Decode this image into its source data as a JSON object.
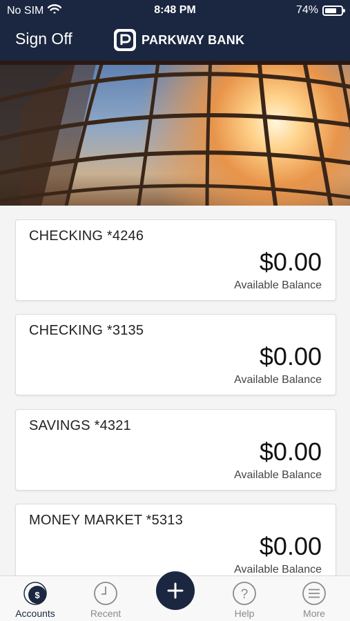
{
  "status_bar": {
    "carrier": "No SIM",
    "time": "8:48 PM",
    "battery": "74%",
    "battery_level": 0.74
  },
  "header": {
    "sign_off_label": "Sign Off",
    "brand_name": "PARKWAY BANK"
  },
  "accounts": [
    {
      "name": "CHECKING *4246",
      "balance": "$0.00",
      "caption": "Available Balance"
    },
    {
      "name": "CHECKING *3135",
      "balance": "$0.00",
      "caption": "Available Balance"
    },
    {
      "name": "SAVINGS *4321",
      "balance": "$0.00",
      "caption": "Available Balance"
    },
    {
      "name": "MONEY MARKET *5313",
      "balance": "$0.00",
      "caption": "Available Balance"
    }
  ],
  "tabbar": {
    "items": [
      {
        "label": "Accounts",
        "icon": "accounts-dollar-icon",
        "active": true
      },
      {
        "label": "Recent",
        "icon": "clock-icon",
        "active": false
      },
      {
        "label": "Help",
        "icon": "question-icon",
        "active": false
      },
      {
        "label": "More",
        "icon": "menu-lines-icon",
        "active": false
      }
    ],
    "fab_icon": "plus-icon"
  },
  "colors": {
    "header_bg": "#1b2740",
    "accent": "#1b2740",
    "page_bg": "#f4f4f4"
  }
}
